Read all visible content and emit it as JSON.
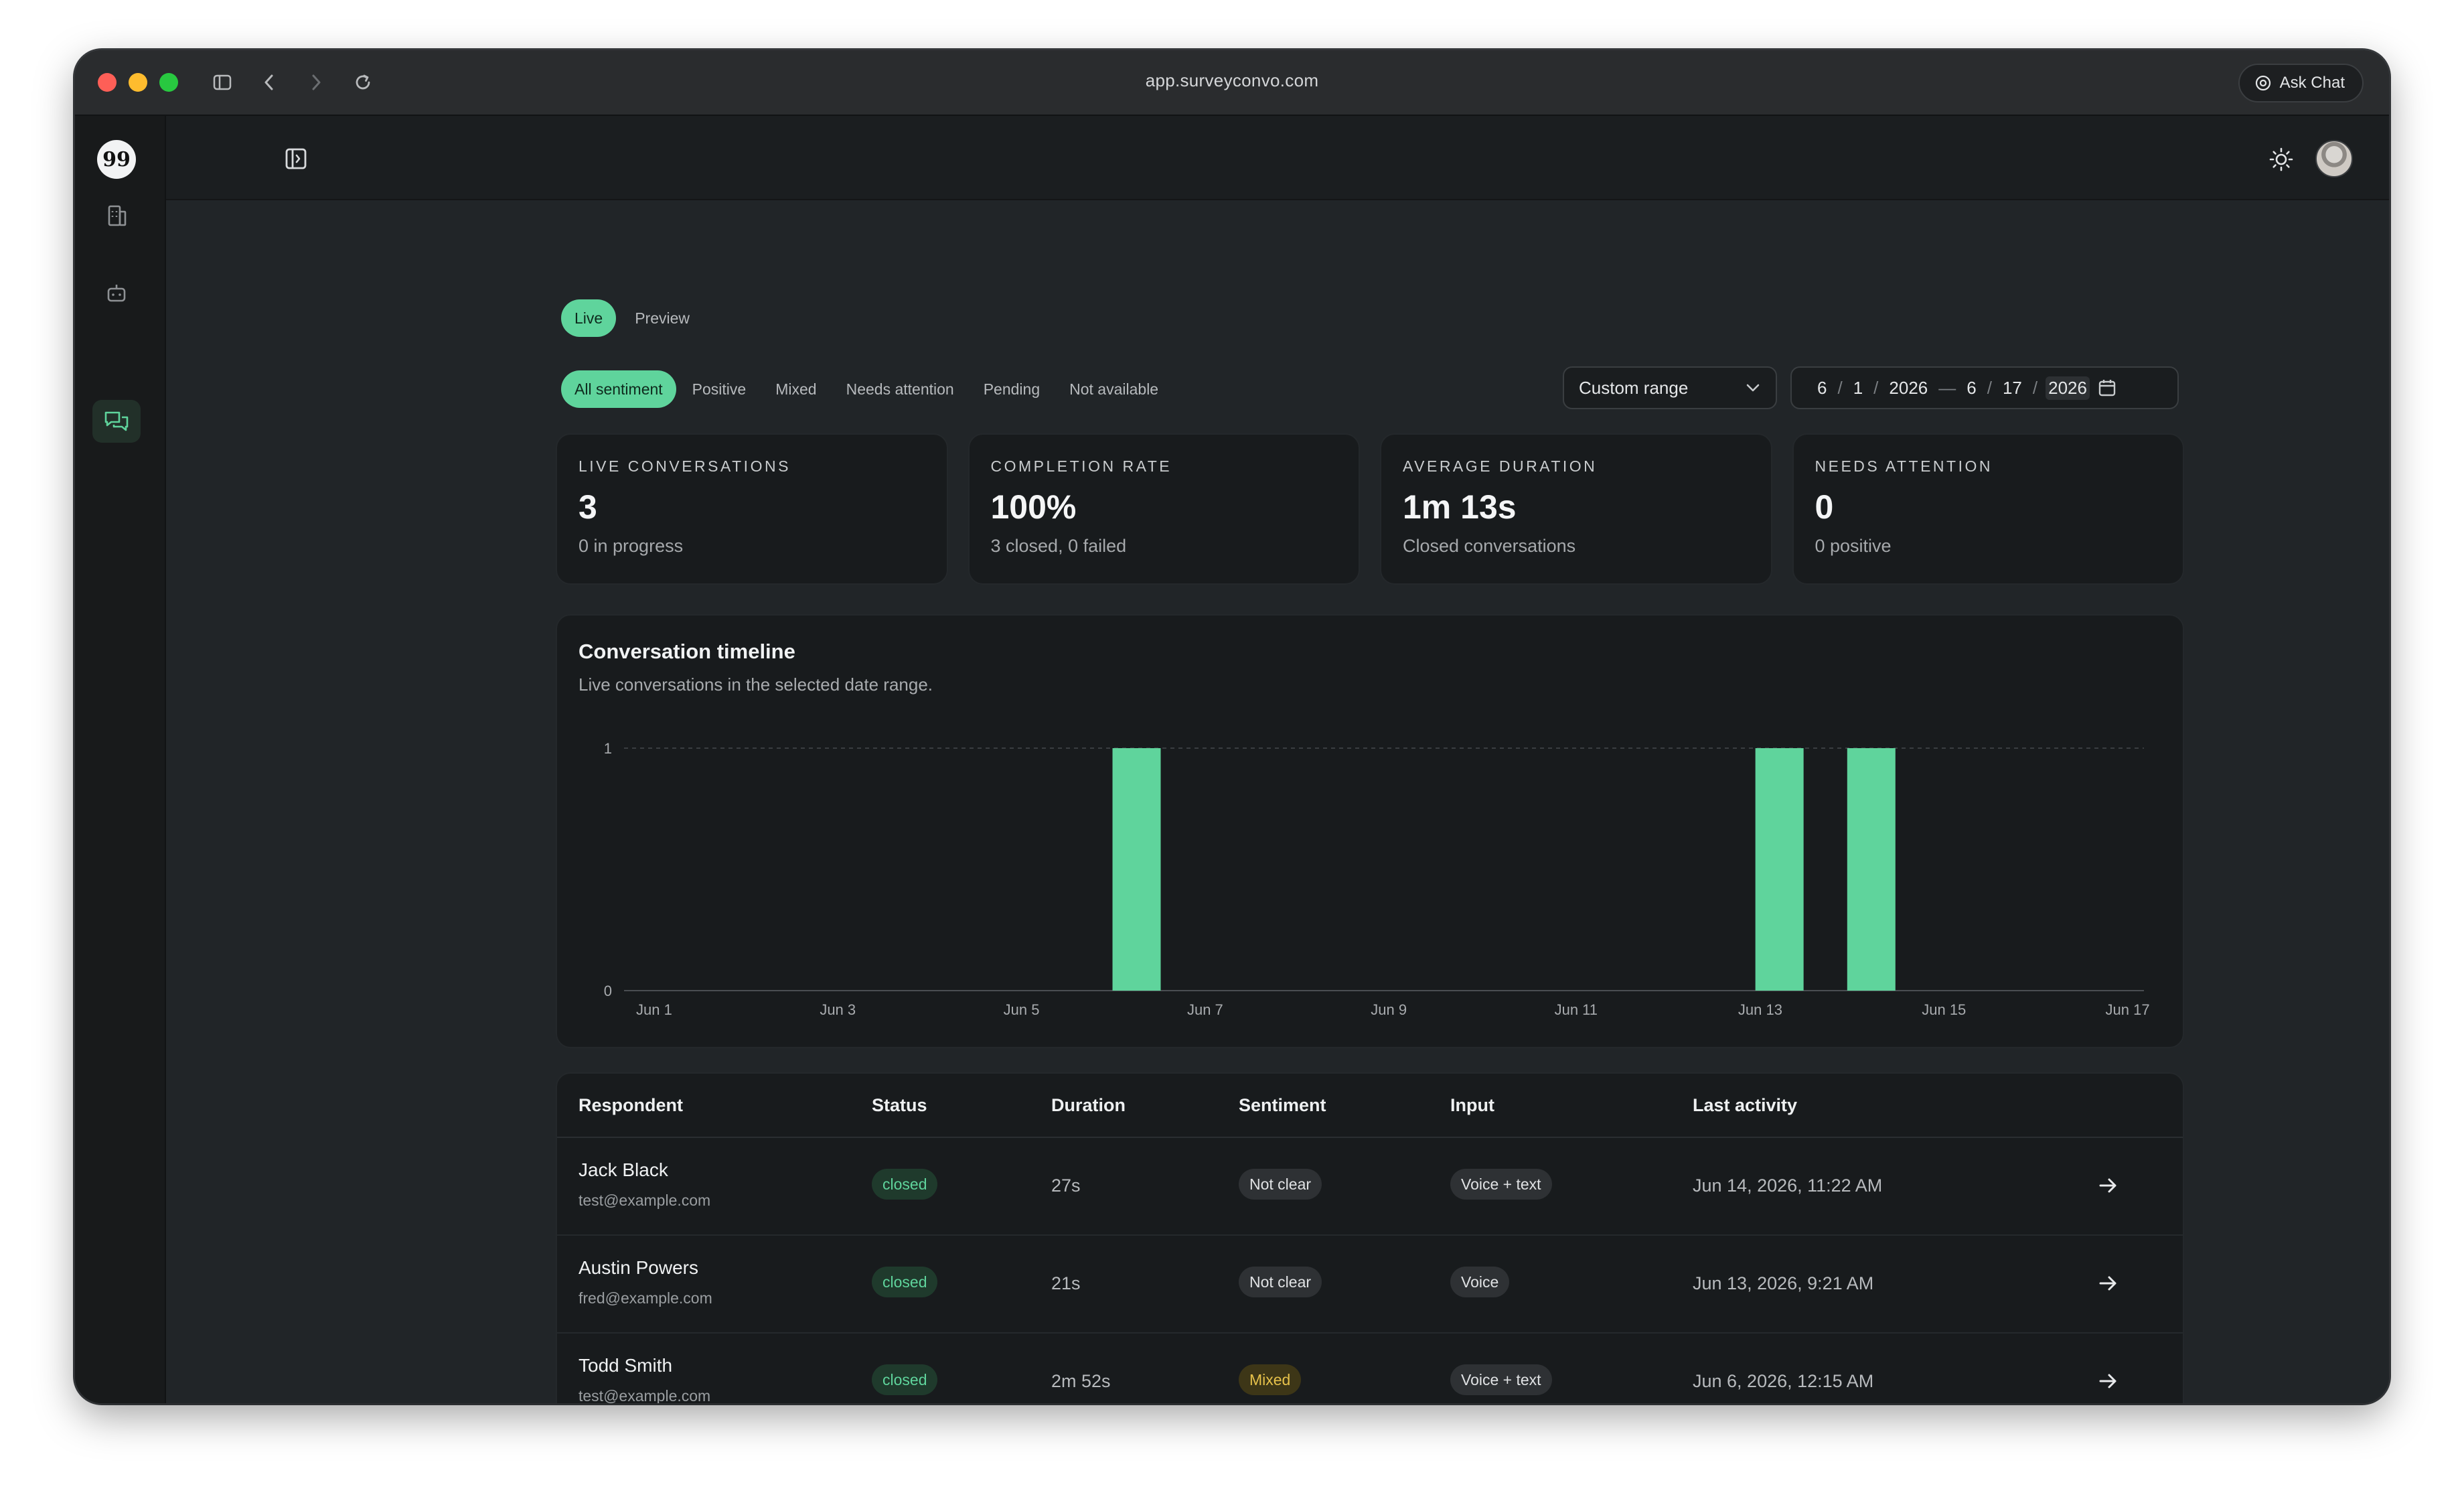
{
  "browser": {
    "url": "app.surveyconvo.com",
    "ask_chat": "Ask Chat"
  },
  "modes": [
    "Live",
    "Preview"
  ],
  "sentiment_filters": [
    "All sentiment",
    "Positive",
    "Mixed",
    "Needs attention",
    "Pending",
    "Not available"
  ],
  "range_select": {
    "value": "Custom range"
  },
  "date_range": {
    "start": {
      "month": "6",
      "day": "1",
      "year": "2026"
    },
    "end": {
      "month": "6",
      "day": "17",
      "year": "2026"
    },
    "dash": "—",
    "slash": "/"
  },
  "kpis": [
    {
      "label": "LIVE CONVERSATIONS",
      "value": "3",
      "sub": "0 in progress"
    },
    {
      "label": "COMPLETION RATE",
      "value": "100%",
      "sub": "3 closed, 0 failed"
    },
    {
      "label": "AVERAGE DURATION",
      "value": "1m 13s",
      "sub": "Closed conversations"
    },
    {
      "label": "NEEDS ATTENTION",
      "value": "0",
      "sub": "0 positive"
    }
  ],
  "chart": {
    "title": "Conversation timeline",
    "subtitle": "Live conversations in the selected date range."
  },
  "chart_data": {
    "type": "bar",
    "categories": [
      "Jun 1",
      "Jun 2",
      "Jun 3",
      "Jun 4",
      "Jun 5",
      "Jun 6",
      "Jun 7",
      "Jun 8",
      "Jun 9",
      "Jun 10",
      "Jun 11",
      "Jun 12",
      "Jun 13",
      "Jun 14",
      "Jun 15",
      "Jun 16",
      "Jun 17"
    ],
    "values": [
      0,
      0,
      0,
      0,
      0,
      1,
      0,
      0,
      0,
      0,
      0,
      0,
      1,
      1,
      0,
      0,
      0
    ],
    "x_tick_labels": [
      "Jun 1",
      "Jun 3",
      "Jun 5",
      "Jun 7",
      "Jun 9",
      "Jun 11",
      "Jun 13",
      "Jun 15",
      "Jun 17"
    ],
    "y_tick_labels": [
      "0",
      "1"
    ],
    "ylim": [
      0,
      1
    ],
    "color": "#5fd49c",
    "grid": "dashed at y=1"
  },
  "table": {
    "headers": [
      "Respondent",
      "Status",
      "Duration",
      "Sentiment",
      "Input",
      "Last activity"
    ],
    "rows": [
      {
        "name": "Jack Black",
        "email": "test@example.com",
        "status": "closed",
        "duration": "27s",
        "sentiment": "Not clear",
        "input": "Voice + text",
        "last_activity": "Jun 14, 2026, 11:22 AM"
      },
      {
        "name": "Austin Powers",
        "email": "fred@example.com",
        "status": "closed",
        "duration": "21s",
        "sentiment": "Not clear",
        "input": "Voice",
        "last_activity": "Jun 13, 2026, 9:21 AM"
      },
      {
        "name": "Todd Smith",
        "email": "test@example.com",
        "status": "closed",
        "duration": "2m 52s",
        "sentiment": "Mixed",
        "input": "Voice + text",
        "last_activity": "Jun 6, 2026, 12:15 AM"
      }
    ]
  },
  "colors": {
    "accent": "#5fd49c",
    "mixed": "#e6c14a",
    "background": "#212528",
    "card": "#181b1d"
  }
}
